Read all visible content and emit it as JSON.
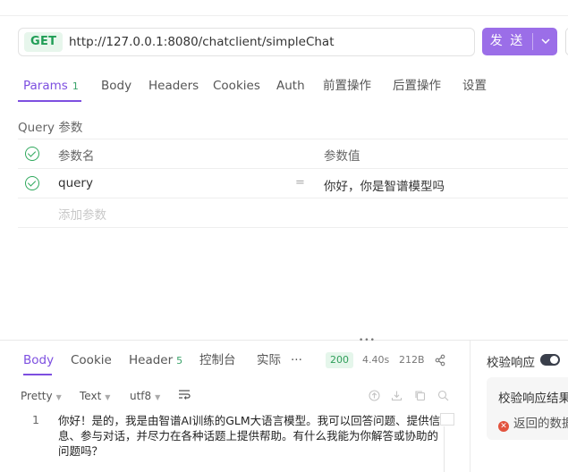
{
  "request": {
    "method": "GET",
    "url": "http://127.0.0.1:8080/chatclient/simpleChat",
    "send_label": "发 送"
  },
  "tabs": [
    {
      "label": "Params",
      "count": "1"
    },
    {
      "label": "Body"
    },
    {
      "label": "Headers"
    },
    {
      "label": "Cookies"
    },
    {
      "label": "Auth"
    },
    {
      "label": "前置操作"
    },
    {
      "label": "后置操作"
    },
    {
      "label": "设置"
    }
  ],
  "query": {
    "section_label": "Query 参数",
    "columns": {
      "name": "参数名",
      "value": "参数值"
    },
    "rows": [
      {
        "name": "query",
        "value": "你好，你是智谱模型吗"
      }
    ],
    "add_placeholder": "添加参数"
  },
  "response": {
    "tabs": [
      {
        "label": "Body"
      },
      {
        "label": "Cookie"
      },
      {
        "label": "Header",
        "count": "5"
      },
      {
        "label": "控制台"
      },
      {
        "label": "实际"
      },
      {
        "label": "···"
      }
    ],
    "status": "200",
    "time": "4.40s",
    "size": "212B",
    "options": {
      "format": "Pretty",
      "type": "Text",
      "encoding": "utf8"
    },
    "line_number": "1",
    "body": "你好！是的，我是由智谱AI训练的GLM大语言模型。我可以回答问题、提供信息、参与对话，并尽力在各种话题上提供帮助。有什么我能为你解答或协助的问题吗？"
  },
  "validation": {
    "title": "校验响应",
    "result_title": "校验响应结果",
    "error_text": "返回的数据"
  },
  "colors": {
    "accent": "#7d4fe0",
    "send_button": "#9b6ee8",
    "success": "#2fa85c",
    "error": "#e2533e"
  }
}
